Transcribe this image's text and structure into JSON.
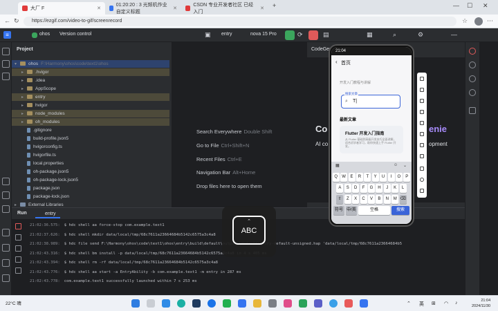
{
  "browser": {
    "tabs": [
      {
        "label": "大厂 F",
        "color": "#e03a3a"
      },
      {
        "label": "01:20:20 : 3 光频机作业自定义标题",
        "color": "#3574f0"
      },
      {
        "label": "CSDN 专业开发者社区 已经入门",
        "color": "#e03a3a"
      }
    ],
    "url": "https://ezgif.com/video-to-gif/screenrecord",
    "controls": [
      "—",
      "☐",
      "✕"
    ]
  },
  "ide": {
    "project_name": "ohos",
    "version_control": "Version control",
    "run_config": "entry",
    "device": "nova 15 Pro",
    "project_panel_title": "Project",
    "root": {
      "name": "ohos",
      "path": "F:\\Harmony\\ohos\\code\\text1\\ohos"
    },
    "tree": [
      {
        "label": ".hvigor",
        "kind": "folder",
        "highlight": true
      },
      {
        "label": ".idea",
        "kind": "folder",
        "highlight": false
      },
      {
        "label": "AppScope",
        "kind": "folder",
        "highlight": false
      },
      {
        "label": "entry",
        "kind": "folder",
        "highlight": true
      },
      {
        "label": "hvigor",
        "kind": "folder",
        "highlight": false
      },
      {
        "label": "node_modules",
        "kind": "folder",
        "highlight": true
      },
      {
        "label": "oh_modules",
        "kind": "folder",
        "highlight": true
      },
      {
        "label": ".gitignore",
        "kind": "file",
        "highlight": false
      },
      {
        "label": "build-profile.json5",
        "kind": "file",
        "highlight": false
      },
      {
        "label": "hvigorconfig.ts",
        "kind": "file",
        "highlight": false
      },
      {
        "label": "hvigorfile.ts",
        "kind": "file",
        "highlight": false
      },
      {
        "label": "local.properties",
        "kind": "file",
        "highlight": false
      },
      {
        "label": "oh-package.json5",
        "kind": "file",
        "highlight": false
      },
      {
        "label": "oh-package-lock.json5",
        "kind": "file",
        "highlight": false
      },
      {
        "label": "package.json",
        "kind": "file",
        "highlight": false
      },
      {
        "label": "package-lock.json",
        "kind": "file",
        "highlight": false
      }
    ],
    "external_libraries": "External Libraries",
    "welcome_hints": [
      {
        "action": "Search Everywhere",
        "keys": "Double Shift"
      },
      {
        "action": "Go to File",
        "keys": "Ctrl+Shift+N"
      },
      {
        "action": "Recent Files",
        "keys": "Ctrl+E"
      },
      {
        "action": "Navigation Bar",
        "keys": "Alt+Home"
      },
      {
        "action": "Drop files here to open them",
        "keys": ""
      }
    ],
    "codegenie": {
      "title": "CodeGenie",
      "big": "Co",
      "big_right": "enie",
      "sub_left": "AI co",
      "sub_right": "opment"
    },
    "run_panel": {
      "title": "Run",
      "tab": "entry"
    },
    "log": [
      {
        "ts": "21:02:36.575:",
        "msg": "$ hdc shell aa force-stop com.example.text1"
      },
      {
        "ts": "21:02:37.626:",
        "msg": "$ hdc shell mkdir data/local/tmp/68c7611a23664684b5142c6575a3c4a8"
      },
      {
        "ts": "21:02:38.989:",
        "msg": "$ hdc file send F:\\Harmony\\ohos\\code\\text1\\ohos\\entry\\build\\default\\outputs\\default\\entry-default-unsigned.hap 'data/local/tmp/68c7611a23664684b5"
      },
      {
        "ts": "21:02:43.316:",
        "msg": "$ hdc shell bm install -p data/local/tmp/68c7611a23664684b5142c6575a3c4a8 in 4 s 405 ms"
      },
      {
        "ts": "21:02:43.394:",
        "msg": "$ hdc shell rm -rf data/local/tmp/68c7611a23664684b5142c6575a3c4a8"
      },
      {
        "ts": "21:02:43.776:",
        "msg": "$ hdc shell aa start -a EntryAbility -b com.example.text1 -m entry in 287 ms"
      },
      {
        "ts": "21:02:43.778:",
        "msg": "com.example.text1 successfully launched within 7 s 253 ms"
      }
    ]
  },
  "phone": {
    "status_time": "21:04",
    "page_title": "首页",
    "section_label": "开发入门教程与讲解",
    "input_caption": "搜索文章",
    "input_value": "T|",
    "recommend_title": "最新文章",
    "card_title": "Flutter 开发入门指南",
    "card_desc": "从 Flutter 基础到高级开发技巧全面讲解，适合初学者学习，助你快速上手 Flutter 开发。",
    "keyboard_rows": [
      [
        "Q",
        "W",
        "E",
        "R",
        "T",
        "Y",
        "U",
        "I",
        "O",
        "P"
      ],
      [
        "A",
        "S",
        "D",
        "F",
        "G",
        "H",
        "J",
        "K",
        "L"
      ],
      [
        "⇧",
        "Z",
        "X",
        "C",
        "V",
        "B",
        "N",
        "M",
        "⌫"
      ]
    ],
    "keyboard_bottom": [
      "符号",
      "中/英",
      "空格",
      "搜索"
    ]
  },
  "overlay": {
    "label": "ABC"
  },
  "taskbar": {
    "weather": "22°C 晴",
    "lang": "英",
    "time": "21:04",
    "date": "2024/11/30"
  }
}
